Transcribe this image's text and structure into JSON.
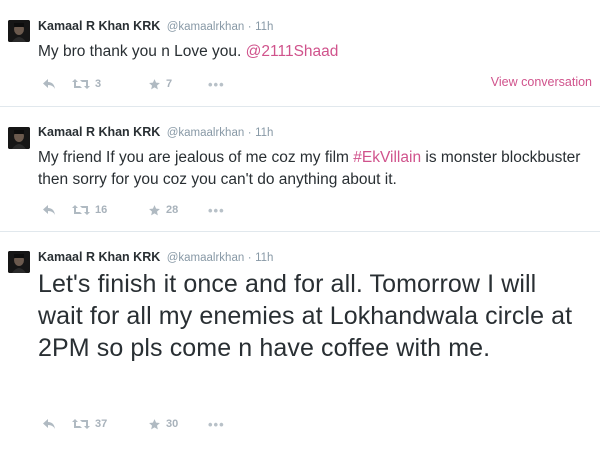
{
  "accent_color": "#d0538c",
  "tweets": [
    {
      "fullname": "Kamaal R Khan KRK",
      "username": "@kamaalrkhan",
      "separator": "·",
      "time": "11h",
      "text_before": "My bro thank you n Love you. ",
      "mention": "@2111Shaad",
      "retweets": "3",
      "favorites": "7",
      "view_conversation": "View conversation"
    },
    {
      "fullname": "Kamaal R Khan KRK",
      "username": "@kamaalrkhan",
      "separator": "·",
      "time": "11h",
      "text_before": "My friend If you are jealous of me coz my film ",
      "hashtag": "#EkVillain",
      "text_after": " is monster blockbuster then sorry for you coz you can't do anything about it.",
      "retweets": "16",
      "favorites": "28"
    },
    {
      "fullname": "Kamaal R Khan KRK",
      "username": "@kamaalrkhan",
      "separator": "·",
      "time": "11h",
      "text": "Let's finish it once and for all. Tomorrow I will wait for all my enemies at Lokhandwala circle at 2PM so pls come n have coffee with me.",
      "retweets": "37",
      "favorites": "30"
    }
  ],
  "icons": {
    "reply": "reply-icon",
    "retweet": "retweet-icon",
    "favorite": "star-icon",
    "more": "more-icon",
    "more_glyph": "•••"
  }
}
